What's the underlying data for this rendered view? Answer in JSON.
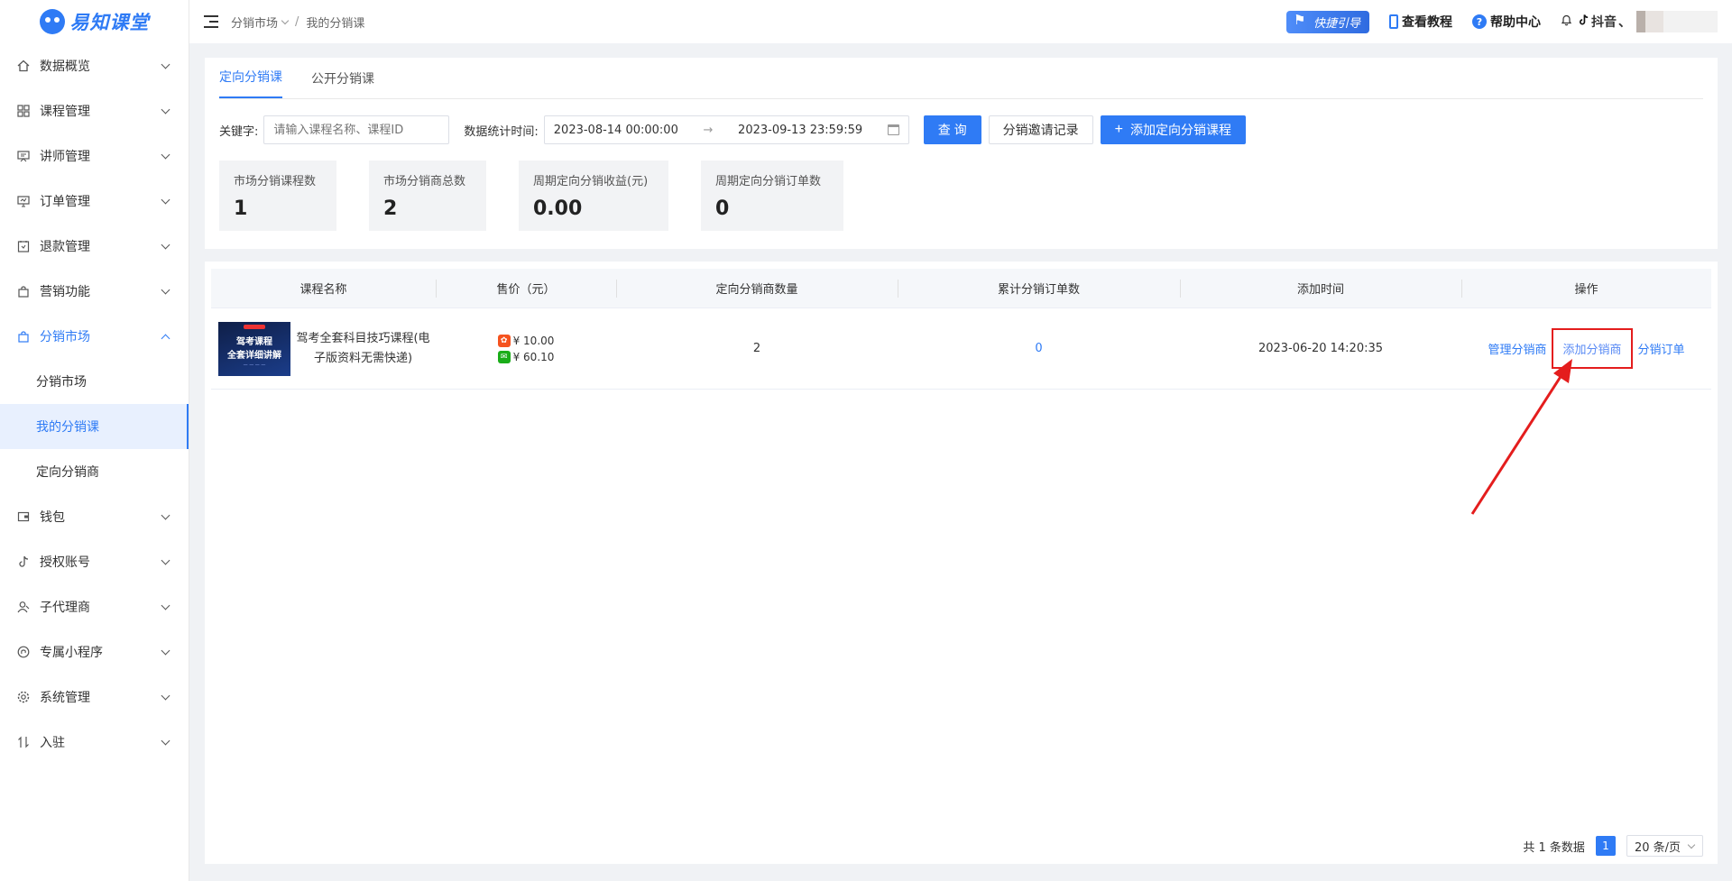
{
  "app": {
    "logo_text": "易知课堂"
  },
  "sidebar": {
    "items": [
      {
        "label": "数据概览",
        "icon": "home-icon"
      },
      {
        "label": "课程管理",
        "icon": "grid-icon"
      },
      {
        "label": "讲师管理",
        "icon": "presenter-icon"
      },
      {
        "label": "订单管理",
        "icon": "monitor-icon"
      },
      {
        "label": "退款管理",
        "icon": "refund-icon"
      },
      {
        "label": "营销功能",
        "icon": "bag-icon"
      },
      {
        "label": "分销市场",
        "icon": "market-icon"
      },
      {
        "label": "钱包",
        "icon": "wallet-icon"
      },
      {
        "label": "授权账号",
        "icon": "tiktok-icon"
      },
      {
        "label": "子代理商",
        "icon": "users-icon"
      },
      {
        "label": "专属小程序",
        "icon": "miniapp-icon"
      },
      {
        "label": "系统管理",
        "icon": "gear-icon"
      },
      {
        "label": "入驻",
        "icon": "transfer-icon"
      }
    ],
    "submenu": [
      "分销市场",
      "我的分销课",
      "定向分销商"
    ]
  },
  "header": {
    "breadcrumb": [
      "分销市场",
      "我的分销课"
    ],
    "quick_guide": "快捷引导",
    "tutorial": "查看教程",
    "help": "帮助中心",
    "platform": "抖音",
    "platform_suffix": "、"
  },
  "tabs": [
    "定向分销课",
    "公开分销课"
  ],
  "filters": {
    "keyword_label": "关键字:",
    "keyword_placeholder": "请输入课程名称、课程ID",
    "date_label": "数据统计时间:",
    "date_start": "2023-08-14 00:00:00",
    "date_arrow": "→",
    "date_end": "2023-09-13 23:59:59",
    "query_btn": "查 询",
    "invite_btn": "分销邀请记录",
    "add_btn": "添加定向分销课程",
    "add_plus": "+"
  },
  "stats": [
    {
      "label": "市场分销课程数",
      "value": "1"
    },
    {
      "label": "市场分销商总数",
      "value": "2"
    },
    {
      "label": "周期定向分销收益(元)",
      "value": "0.00"
    },
    {
      "label": "周期定向分销订单数",
      "value": "0"
    }
  ],
  "table": {
    "headers": [
      "课程名称",
      "售价（元）",
      "定向分销商数量",
      "累计分销订单数",
      "添加时间",
      "操作"
    ],
    "rows": [
      {
        "thumb_line1": "驾考课程",
        "thumb_line2": "全套详细讲解",
        "name": "驾考全套科目技巧课程(电子版资料无需快递)",
        "price1": "¥ 10.00",
        "price2": "¥ 60.10",
        "distributors": "2",
        "orders": "0",
        "added": "2023-06-20 14:20:35",
        "op_manage": "管理分销商",
        "op_add": "添加分销商",
        "op_orders": "分销订单"
      }
    ]
  },
  "pagination": {
    "total": "共 1 条数据",
    "page": "1",
    "size": "20 条/页"
  },
  "colors": {
    "primary": "#2f7bf5",
    "highlight": "#e41d1d"
  }
}
